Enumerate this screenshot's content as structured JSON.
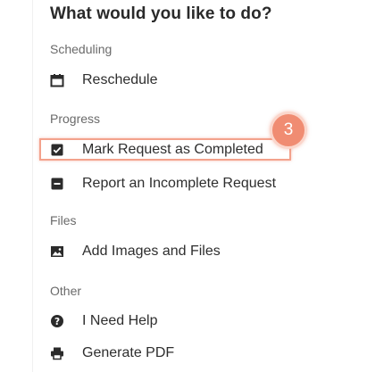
{
  "panel": {
    "title": "What would you like to do?"
  },
  "sections": [
    {
      "label": "Scheduling",
      "items": [
        {
          "label": "Reschedule",
          "icon": "calendar-icon"
        }
      ]
    },
    {
      "label": "Progress",
      "items": [
        {
          "label": "Mark Request as Completed",
          "icon": "checkbox-checked-icon"
        },
        {
          "label": "Report an Incomplete Request",
          "icon": "minus-square-icon"
        }
      ]
    },
    {
      "label": "Files",
      "items": [
        {
          "label": "Add Images and Files",
          "icon": "image-icon"
        }
      ]
    },
    {
      "label": "Other",
      "items": [
        {
          "label": "I Need Help",
          "icon": "help-circle-icon"
        },
        {
          "label": "Generate PDF",
          "icon": "printer-icon"
        }
      ]
    }
  ],
  "annotation": {
    "step_number": "3",
    "color": "#f08c72"
  }
}
